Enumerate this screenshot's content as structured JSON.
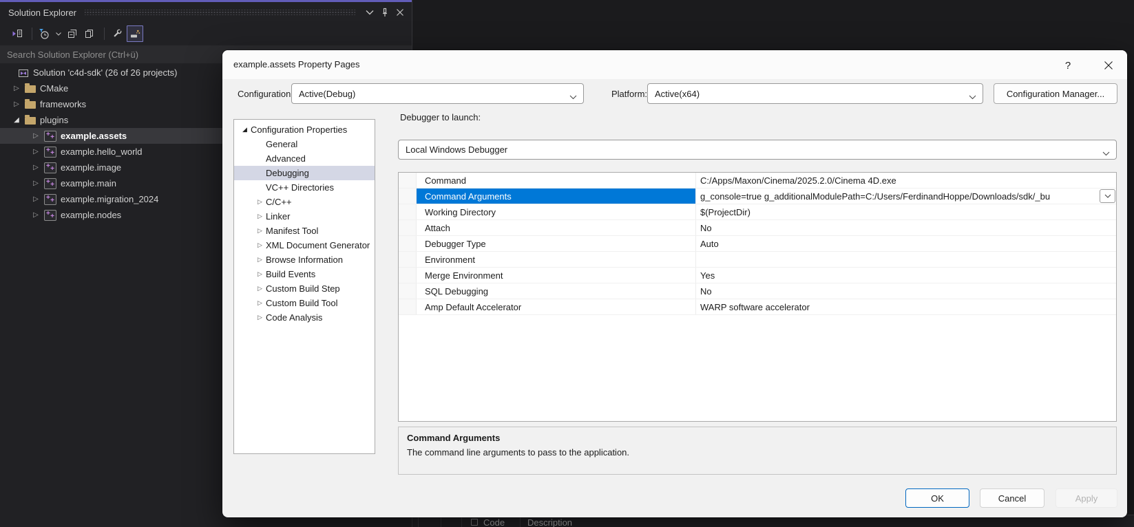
{
  "colors": {
    "accent_purple": "#625db8",
    "selection_blue": "#0078d7",
    "dialog_tree_selection": "#d4d7e5",
    "folder_tan": "#c4a66b",
    "project_plus_purple": "#c586e0",
    "ok_border_blue": "#0067c0",
    "dark_panel": "#212124"
  },
  "background": {
    "error_list": {
      "columns": [
        "Code",
        "Description"
      ]
    }
  },
  "solution_explorer": {
    "title": "Solution Explorer",
    "search_placeholder": "Search Solution Explorer (Ctrl+ü)",
    "toolbar_icons": [
      "sync-with-active-document",
      "timeline-filter",
      "collapse-all",
      "show-all-files",
      "properties-wrench",
      "preview-selected-items"
    ],
    "titlebar_icons": [
      "window-menu-chevron",
      "pin",
      "close"
    ],
    "tree": [
      {
        "label": "Solution 'c4d-sdk' (26 of 26 projects)",
        "icon": "solution",
        "expander": "none",
        "level": 0
      },
      {
        "label": "CMake",
        "icon": "folder",
        "expander": "collapsed",
        "level": 1
      },
      {
        "label": "frameworks",
        "icon": "folder",
        "expander": "collapsed",
        "level": 1
      },
      {
        "label": "plugins",
        "icon": "folder",
        "expander": "expanded",
        "level": 1
      },
      {
        "label": "example.assets",
        "icon": "project",
        "expander": "collapsed",
        "level": 2,
        "selected": true
      },
      {
        "label": "example.hello_world",
        "icon": "project",
        "expander": "collapsed",
        "level": 2
      },
      {
        "label": "example.image",
        "icon": "project",
        "expander": "collapsed",
        "level": 2
      },
      {
        "label": "example.main",
        "icon": "project",
        "expander": "collapsed",
        "level": 2
      },
      {
        "label": "example.migration_2024",
        "icon": "project",
        "expander": "collapsed",
        "level": 2
      },
      {
        "label": "example.nodes",
        "icon": "project",
        "expander": "collapsed",
        "level": 2
      }
    ]
  },
  "dialog": {
    "title": "example.assets Property Pages",
    "help_icon": "?",
    "configuration": {
      "label": "Configuration:",
      "value": "Active(Debug)"
    },
    "platform": {
      "label": "Platform:",
      "value": "Active(x64)"
    },
    "configuration_manager_button": "Configuration Manager...",
    "tree": [
      {
        "label": "Configuration Properties",
        "expander": "expanded",
        "level": 0
      },
      {
        "label": "General",
        "expander": "none",
        "level": 1
      },
      {
        "label": "Advanced",
        "expander": "none",
        "level": 1
      },
      {
        "label": "Debugging",
        "expander": "none",
        "level": 1,
        "selected": true
      },
      {
        "label": "VC++ Directories",
        "expander": "none",
        "level": 1
      },
      {
        "label": "C/C++",
        "expander": "collapsed",
        "level": 1
      },
      {
        "label": "Linker",
        "expander": "collapsed",
        "level": 1
      },
      {
        "label": "Manifest Tool",
        "expander": "collapsed",
        "level": 1
      },
      {
        "label": "XML Document Generator",
        "expander": "collapsed",
        "level": 1
      },
      {
        "label": "Browse Information",
        "expander": "collapsed",
        "level": 1
      },
      {
        "label": "Build Events",
        "expander": "collapsed",
        "level": 1
      },
      {
        "label": "Custom Build Step",
        "expander": "collapsed",
        "level": 1
      },
      {
        "label": "Custom Build Tool",
        "expander": "collapsed",
        "level": 1
      },
      {
        "label": "Code Analysis",
        "expander": "collapsed",
        "level": 1
      }
    ],
    "debugger": {
      "label": "Debugger to launch:",
      "value": "Local Windows Debugger"
    },
    "properties": [
      {
        "name": "Command",
        "value": "C:/Apps/Maxon/Cinema/2025.2.0/Cinema 4D.exe"
      },
      {
        "name": "Command Arguments",
        "value": "g_console=true g_additionalModulePath=C:/Users/FerdinandHoppe/Downloads/sdk/_bu",
        "selected": true,
        "editor": "dropdown"
      },
      {
        "name": "Working Directory",
        "value": "$(ProjectDir)"
      },
      {
        "name": "Attach",
        "value": "No"
      },
      {
        "name": "Debugger Type",
        "value": "Auto"
      },
      {
        "name": "Environment",
        "value": ""
      },
      {
        "name": "Merge Environment",
        "value": "Yes"
      },
      {
        "name": "SQL Debugging",
        "value": "No"
      },
      {
        "name": "Amp Default Accelerator",
        "value": "WARP software accelerator"
      }
    ],
    "description": {
      "title": "Command Arguments",
      "text": "The command line arguments to pass to the application."
    },
    "buttons": {
      "ok": "OK",
      "cancel": "Cancel",
      "apply": "Apply"
    }
  }
}
